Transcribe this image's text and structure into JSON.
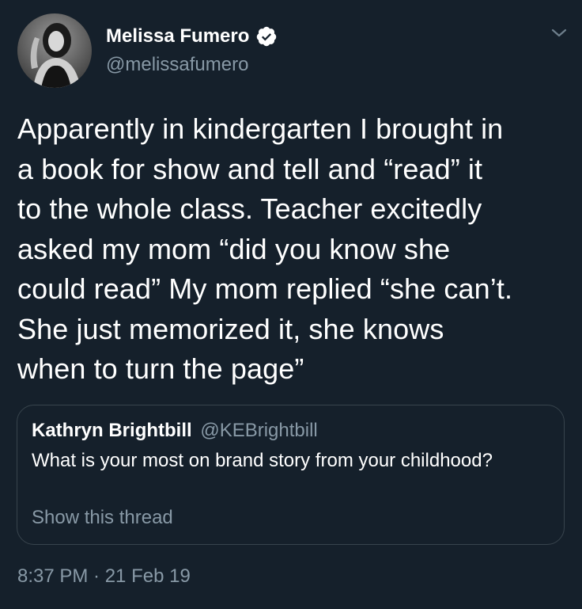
{
  "tweet": {
    "author": {
      "display_name": "Melissa Fumero",
      "handle": "@melissafumero",
      "verified": true,
      "avatar_icon": "profile-photo-icon"
    },
    "text": "Apparently in kindergarten I brought in\na book for show and tell and “read” it\nto the whole class. Teacher excitedly\nasked my mom “did you know she\ncould read” My mom replied “she can’t.\nShe just memorized it, she knows\nwhen to turn the page”",
    "quoted_tweet": {
      "display_name": "Kathryn Brightbill",
      "handle": "@KEBrightbill",
      "text": "What is your most on brand story from your childhood?",
      "show_thread_label": "Show this thread"
    },
    "timestamp": "8:37 PM · 21 Feb 19"
  },
  "colors": {
    "background": "#15202b",
    "primary_text": "#ffffff",
    "secondary_text": "#8899a6",
    "border": "#38444d"
  },
  "icons": {
    "verified": "verified-badge-icon",
    "menu": "chevron-down-icon"
  }
}
